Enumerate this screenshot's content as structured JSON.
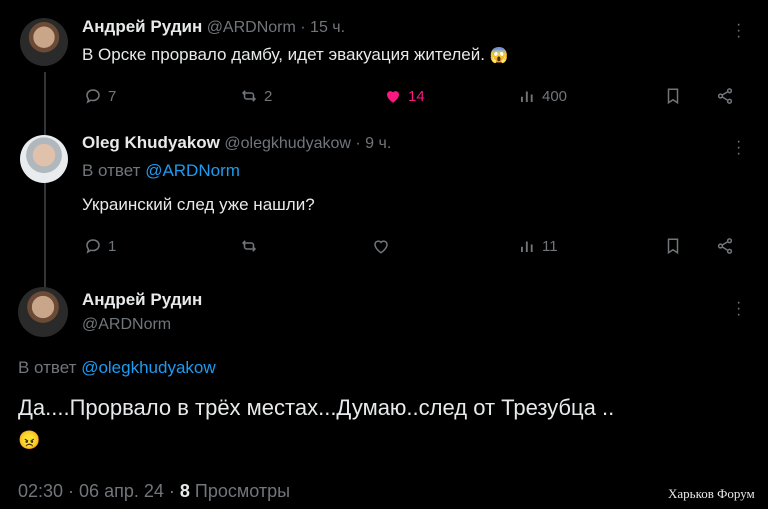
{
  "tweet1": {
    "name": "Андрей Рудин",
    "handle": "@ARDNorm",
    "time": "· 15 ч.",
    "text": "В Орске прорвало дамбу, идет эвакуация жителей.",
    "emoji": "😱",
    "actions": {
      "replies": "7",
      "reposts": "2",
      "likes": "14",
      "views": "400"
    },
    "like_color": "#f91880"
  },
  "tweet2": {
    "name": "Oleg Khudyakow",
    "handle": "@olegkhudyakow",
    "time": "· 9 ч.",
    "reply_prefix": "В ответ",
    "reply_to": "@ARDNorm",
    "text": "Украинский след уже нашли?",
    "actions": {
      "replies": "1",
      "reposts": "",
      "likes": "",
      "views": "11"
    }
  },
  "tweet3": {
    "name": "Андрей Рудин",
    "handle": "@ARDNorm",
    "reply_prefix": "В ответ",
    "reply_to": "@olegkhudyakow",
    "text": "Да....Прорвало в трёх местах...Думаю..след от Трезубца ..",
    "emoji": "😠",
    "time": "02:30 · 06 апр. 24 ·",
    "views_count": "8",
    "views_label": "Просмотры"
  },
  "watermark": "Харьков Форум",
  "colors": {
    "background": "#000000",
    "text": "#e7e9ea",
    "muted": "#71767b",
    "link": "#1d9bf0",
    "like": "#f91880"
  }
}
